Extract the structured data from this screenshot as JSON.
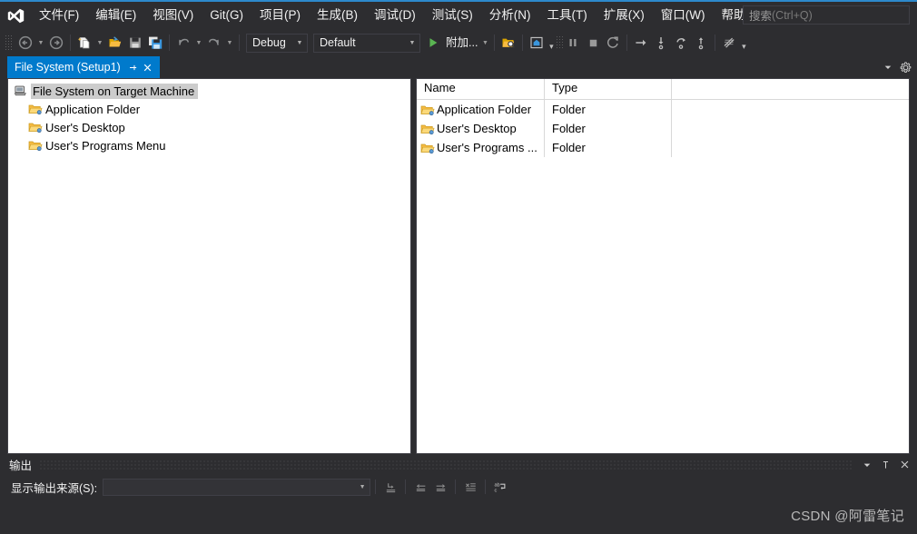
{
  "app": {
    "accent_blue": "#007acc",
    "titlebar_blue": "#2d89cc",
    "chrome_bg": "#2d2d30",
    "border": "#3f3f46",
    "pane_bg": "#ffffff",
    "text_light": "#f1f1f1"
  },
  "menubar": {
    "logo_name": "visual-studio-logo",
    "items": [
      {
        "label": "文件(F)",
        "accel": "F"
      },
      {
        "label": "编辑(E)",
        "accel": "E"
      },
      {
        "label": "视图(V)",
        "accel": "V"
      },
      {
        "label": "Git(G)",
        "accel": "G"
      },
      {
        "label": "项目(P)",
        "accel": "P"
      },
      {
        "label": "生成(B)",
        "accel": "B"
      },
      {
        "label": "调试(D)",
        "accel": "D"
      },
      {
        "label": "测试(S)",
        "accel": "S"
      },
      {
        "label": "分析(N)",
        "accel": "N"
      },
      {
        "label": "工具(T)",
        "accel": "T"
      },
      {
        "label": "扩展(X)",
        "accel": "X"
      },
      {
        "label": "窗口(W)",
        "accel": "W"
      },
      {
        "label": "帮助(H)",
        "accel": "H"
      }
    ]
  },
  "search": {
    "placeholder_main": "搜索",
    "placeholder_hint": " (Ctrl+Q)"
  },
  "toolbar": {
    "icons": [
      "navigate-backward-icon",
      "navigate-forward-icon",
      "new-project-icon",
      "open-file-icon",
      "save-icon",
      "save-all-icon",
      "undo-icon",
      "redo-icon",
      "start-debug-icon",
      "find-in-files-icon",
      "preview-selected-items-icon",
      "pause-icon",
      "stop-icon",
      "restart-icon",
      "step-over-icon",
      "step-into-icon",
      "step-out-icon",
      "step-up-icon",
      "debug-settings-icon"
    ],
    "config_combo": {
      "value": "Debug",
      "name": "solution-configurations"
    },
    "platform_combo": {
      "value": "Default",
      "name": "solution-platforms"
    },
    "attach_label": "附加...",
    "overflow_label": "▾"
  },
  "tabstrip": {
    "tab": {
      "label": "File System (Setup1)",
      "pin_icon": "pin-icon",
      "close_icon": "close-icon"
    },
    "dropdown_icon": "chevron-down-icon",
    "settings_icon": "gear-icon"
  },
  "tree": {
    "root": {
      "label": "File System on Target Machine",
      "icon": "target-machine-icon",
      "selected": true
    },
    "children": [
      {
        "label": "Application Folder",
        "icon": "folder-icon"
      },
      {
        "label": "User's Desktop",
        "icon": "folder-icon"
      },
      {
        "label": "User's Programs Menu",
        "icon": "folder-icon"
      }
    ]
  },
  "listview": {
    "columns": [
      "Name",
      "Type",
      ""
    ],
    "rows": [
      {
        "name": "Application Folder",
        "type": "Folder",
        "icon": "folder-icon"
      },
      {
        "name": "User's Desktop",
        "type": "Folder",
        "icon": "folder-icon"
      },
      {
        "name": "User's Programs ...",
        "type": "Folder",
        "icon": "folder-icon"
      }
    ]
  },
  "output_panel": {
    "title": "输出",
    "source_label": "显示输出来源(S):",
    "source_value": "",
    "dropdown_icon": "chevron-down-icon",
    "pin_icon": "pin-icon",
    "close_icon": "close-icon",
    "toolbar_icons": [
      "go-to-message-icon",
      "previous-message-icon",
      "next-message-icon",
      "clear-all-icon",
      "toggle-word-wrap-icon"
    ]
  },
  "watermark": {
    "text": "CSDN @阿雷笔记"
  }
}
